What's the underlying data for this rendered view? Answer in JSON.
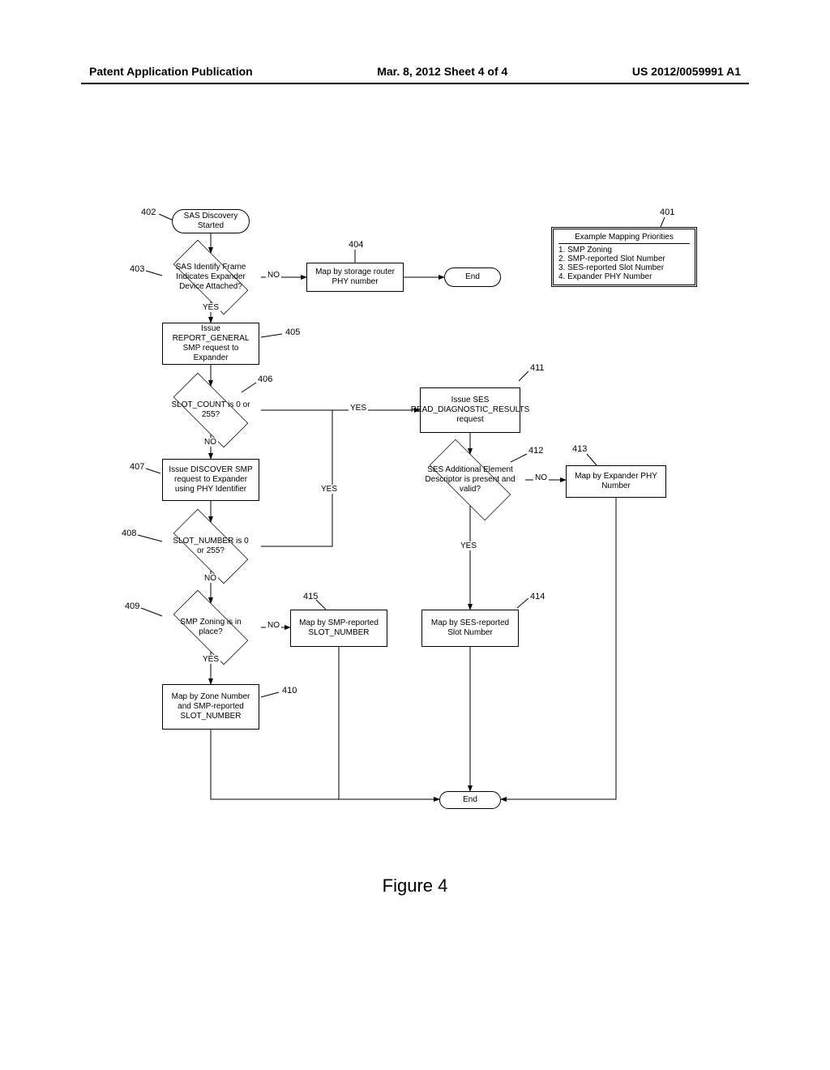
{
  "header": {
    "left": "Patent Application Publication",
    "center": "Mar. 8, 2012  Sheet 4 of 4",
    "right": "US 2012/0059991 A1"
  },
  "figureCaption": "Figure 4",
  "priorities": {
    "title": "Example Mapping Priorities",
    "items": [
      "1. SMP Zoning",
      "2. SMP-reported Slot Number",
      "3. SES-reported Slot Number",
      "4. Expander PHY Number"
    ],
    "ref": "401"
  },
  "nodes": {
    "n402": {
      "ref": "402",
      "text": "SAS Discovery Started"
    },
    "n403": {
      "ref": "403",
      "text": "SAS Identify Frame Indicates Expander Device Attached?"
    },
    "n404": {
      "ref": "404",
      "text": "Map by storage router PHY number"
    },
    "n404end": {
      "text": "End"
    },
    "n405": {
      "ref": "405",
      "text": "Issue REPORT_GENERAL SMP request to Expander"
    },
    "n406": {
      "ref": "406",
      "text": "SLOT_COUNT is 0 or 255?"
    },
    "n407": {
      "ref": "407",
      "text": "Issue DISCOVER SMP request to Expander using PHY Identifier"
    },
    "n408": {
      "ref": "408",
      "text": "SLOT_NUMBER is 0 or 255?"
    },
    "n409": {
      "ref": "409",
      "text": "SMP Zoning is in place?"
    },
    "n410": {
      "ref": "410",
      "text": "Map by Zone Number and SMP-reported SLOT_NUMBER"
    },
    "n411": {
      "ref": "411",
      "text": "Issue SES READ_DIAGNOSTIC_RESULTS request"
    },
    "n412": {
      "ref": "412",
      "text": "SES Additional Element Descriptor is present and valid?"
    },
    "n413": {
      "ref": "413",
      "text": "Map by Expander PHY Number"
    },
    "n414": {
      "ref": "414",
      "text": "Map by SES-reported Slot Number"
    },
    "n415": {
      "ref": "415",
      "text": "Map by SMP-reported SLOT_NUMBER"
    },
    "nEnd": {
      "text": "End"
    }
  },
  "edgeLabels": {
    "e403no": "NO",
    "e403yes": "YES",
    "e406yes": "YES",
    "e406no": "NO",
    "e408yes": "YES",
    "e408no": "NO",
    "e409no": "NO",
    "e409yes": "YES",
    "e412yes": "YES",
    "e412no": "NO"
  }
}
